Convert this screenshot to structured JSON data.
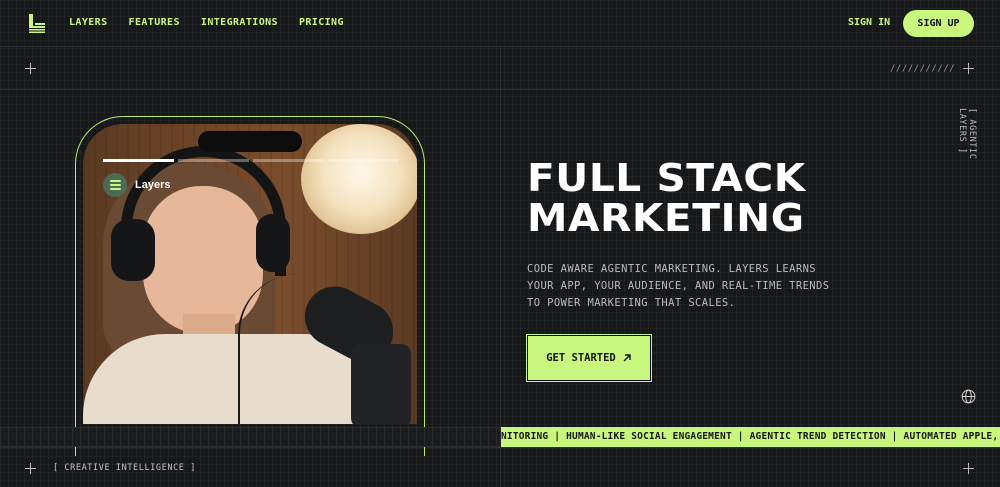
{
  "nav": {
    "links": [
      "LAYERS",
      "FEATURES",
      "INTEGRATIONS",
      "PRICING"
    ],
    "signin": "SIGN IN",
    "signup": "SIGN UP"
  },
  "decor": {
    "slashes": "///////////",
    "vertical_label": "[ AGENTIC LAYERS ]",
    "bottom_label": "[ CREATIVE INTELLIGENCE ]"
  },
  "phone": {
    "badge_label": "Layers",
    "story_progress": {
      "segments": 4,
      "completed": 1
    }
  },
  "hero": {
    "title_line1": "FULL STACK",
    "title_line2": "MARKETING",
    "description": "CODE AWARE AGENTIC MARKETING. LAYERS LEARNS YOUR APP, YOUR AUDIENCE, AND REAL-TIME TRENDS TO POWER MARKETING THAT SCALES.",
    "cta": "GET STARTED"
  },
  "ticker": {
    "text": "NITORING | HUMAN-LIKE SOCIAL ENGAGEMENT | AGENTIC TREND DETECTION | AUTOMATED APPLE, META & TIKTOK"
  },
  "colors": {
    "accent": "#c9f77d",
    "background": "#17181a",
    "text_light": "#ffffff"
  },
  "icons": [
    "layers-logo-icon",
    "plus-icon",
    "arrow-up-right-icon",
    "globe-icon",
    "layers-badge-icon"
  ]
}
